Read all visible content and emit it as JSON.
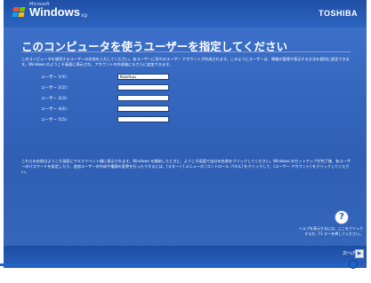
{
  "header": {
    "ms_label": "Microsoft",
    "brand": "Windows",
    "brand_suffix": "xp",
    "vendor": "TOSHIBA"
  },
  "main": {
    "title": "このコンピュータを使うユーザーを指定してください",
    "description": "このコンピュータを使用するユーザーの名前を入力してください。各ユーザーに別々のユーザー アカウントが作成されます。このようにユーザーは、情報の管理や表示する方法を個別に設定できます。Windows のようこそ画面に表示され、アカウントの作成後にもさらに追加できます。",
    "users": [
      {
        "label": "ユーザー 1(Y):",
        "value": "Kaichuu"
      },
      {
        "label": "ユーザー 2(2):",
        "value": ""
      },
      {
        "label": "ユーザー 3(3):",
        "value": ""
      },
      {
        "label": "ユーザー 4(4):",
        "value": ""
      },
      {
        "label": "ユーザー 5(5):",
        "value": ""
      }
    ],
    "note": "これらの名前はようこそ画面にアルファベット順に表示されます。Windows を開始したときに、ようこそ画面で自分の名前をクリックしてください。Windows のセットアップが完了後、各ユーザーのパスワードを設定したり、追加ユーザーの作成や権限の変更を行ったりするには、[スタート] メニューの [コントロール パネル] をクリックして、[ユーザー アカウント] をクリックしてください。"
  },
  "help": {
    "icon": "?",
    "text": "ヘルプを表示するには、ここをクリックするか、F1 キーを押してください。"
  },
  "footer": {
    "next_label": "次へ(N)",
    "next_arrow": "▶"
  }
}
